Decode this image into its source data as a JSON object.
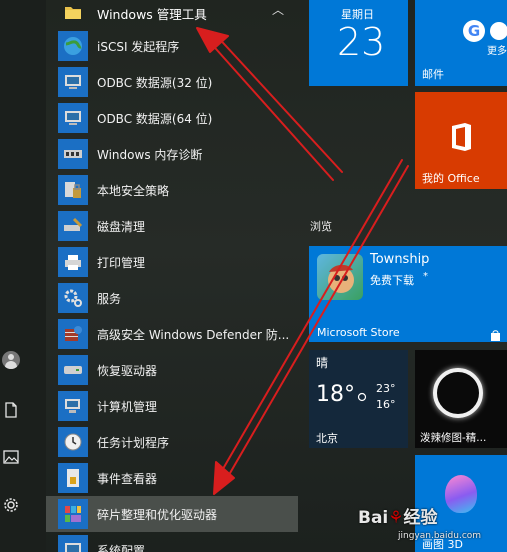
{
  "app_list": {
    "group_header": {
      "label": "Windows 管理工具",
      "icon": "folder-icon"
    },
    "items": [
      {
        "label": "iSCSI 发起程序",
        "icon": "globe-icon"
      },
      {
        "label": "ODBC 数据源(32 位)",
        "icon": "database-icon"
      },
      {
        "label": "ODBC 数据源(64 位)",
        "icon": "database-icon"
      },
      {
        "label": "Windows 内存诊断",
        "icon": "memory-chip-icon"
      },
      {
        "label": "本地安全策略",
        "icon": "security-policy-icon"
      },
      {
        "label": "磁盘清理",
        "icon": "disk-cleanup-icon"
      },
      {
        "label": "打印管理",
        "icon": "printer-icon"
      },
      {
        "label": "服务",
        "icon": "gear-icon"
      },
      {
        "label": "高级安全 Windows Defender 防...",
        "icon": "firewall-icon"
      },
      {
        "label": "恢复驱动器",
        "icon": "drive-icon"
      },
      {
        "label": "计算机管理",
        "icon": "computer-icon"
      },
      {
        "label": "任务计划程序",
        "icon": "clock-icon"
      },
      {
        "label": "事件查看器",
        "icon": "event-viewer-icon"
      },
      {
        "label": "碎片整理和优化驱动器",
        "icon": "defrag-icon"
      },
      {
        "label": "系统配置",
        "icon": "system-config-icon"
      }
    ]
  },
  "tiles": {
    "calendar": {
      "day_label": "星期日",
      "date": "23"
    },
    "mail": {
      "label": "邮件",
      "more": "更多"
    },
    "office": {
      "label": "我的 Office"
    },
    "section_browse": "浏览",
    "store": {
      "app_name": "Township",
      "subtitle": "免费下载",
      "star": "*",
      "store_label": "Microsoft Store"
    },
    "weather": {
      "condition": "晴",
      "temp": "18°",
      "high": "23°",
      "low": "16°",
      "city": "北京"
    },
    "photo_tile": {
      "label": "泼辣修图-精..."
    },
    "paint3d": {
      "label": "画图 3D"
    }
  },
  "watermark": {
    "brand": "Bai",
    "brand2": "经验",
    "url": "jingyan.baidu.com"
  },
  "colors": {
    "accent_blue": "#0078d7",
    "office_orange": "#d83b01",
    "selected_row": "#4a4f4b",
    "annotation_red": "#d81e1e"
  }
}
